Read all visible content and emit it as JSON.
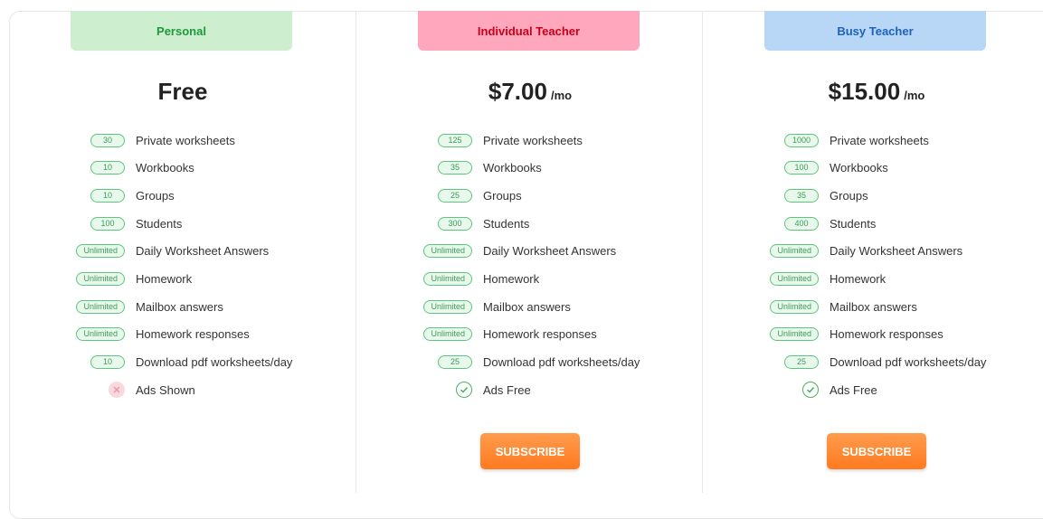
{
  "colors": {
    "personal_bg": "#cdeecf",
    "personal_text": "#1e9a3a",
    "teacher_bg": "#ffa8bd",
    "teacher_text": "#c8001a",
    "busy_bg": "#b8d6f6",
    "busy_text": "#1f62b5",
    "subscribe": "#ff8a2e"
  },
  "plans": [
    {
      "name": "Personal",
      "price": "Free",
      "per": "",
      "features": [
        {
          "badge": "30",
          "label": "Private worksheets"
        },
        {
          "badge": "10",
          "label": "Workbooks"
        },
        {
          "badge": "10",
          "label": "Groups"
        },
        {
          "badge": "100",
          "label": "Students"
        },
        {
          "badge": "Unlimited",
          "label": "Daily Worksheet Answers"
        },
        {
          "badge": "Unlimited",
          "label": "Homework"
        },
        {
          "badge": "Unlimited",
          "label": "Mailbox answers"
        },
        {
          "badge": "Unlimited",
          "label": "Homework responses"
        },
        {
          "badge": "10",
          "label": "Download pdf worksheets/day"
        },
        {
          "icon": "x-circle-icon",
          "label": "Ads Shown"
        }
      ],
      "subscribe_label": ""
    },
    {
      "name": "Individual Teacher",
      "price": "$7.00",
      "per": "/mo",
      "features": [
        {
          "badge": "125",
          "label": "Private worksheets"
        },
        {
          "badge": "35",
          "label": "Workbooks"
        },
        {
          "badge": "25",
          "label": "Groups"
        },
        {
          "badge": "300",
          "label": "Students"
        },
        {
          "badge": "Unlimited",
          "label": "Daily Worksheet Answers"
        },
        {
          "badge": "Unlimited",
          "label": "Homework"
        },
        {
          "badge": "Unlimited",
          "label": "Mailbox answers"
        },
        {
          "badge": "Unlimited",
          "label": "Homework responses"
        },
        {
          "badge": "25",
          "label": "Download pdf worksheets/day"
        },
        {
          "icon": "check-circle-icon",
          "label": "Ads Free"
        }
      ],
      "subscribe_label": "SUBSCRIBE"
    },
    {
      "name": "Busy Teacher",
      "price": "$15.00",
      "per": "/mo",
      "features": [
        {
          "badge": "1000",
          "label": "Private worksheets"
        },
        {
          "badge": "100",
          "label": "Workbooks"
        },
        {
          "badge": "35",
          "label": "Groups"
        },
        {
          "badge": "400",
          "label": "Students"
        },
        {
          "badge": "Unlimited",
          "label": "Daily Worksheet Answers"
        },
        {
          "badge": "Unlimited",
          "label": "Homework"
        },
        {
          "badge": "Unlimited",
          "label": "Mailbox answers"
        },
        {
          "badge": "Unlimited",
          "label": "Homework responses"
        },
        {
          "badge": "25",
          "label": "Download pdf worksheets/day"
        },
        {
          "icon": "check-circle-icon",
          "label": "Ads Free"
        }
      ],
      "subscribe_label": "SUBSCRIBE"
    }
  ]
}
